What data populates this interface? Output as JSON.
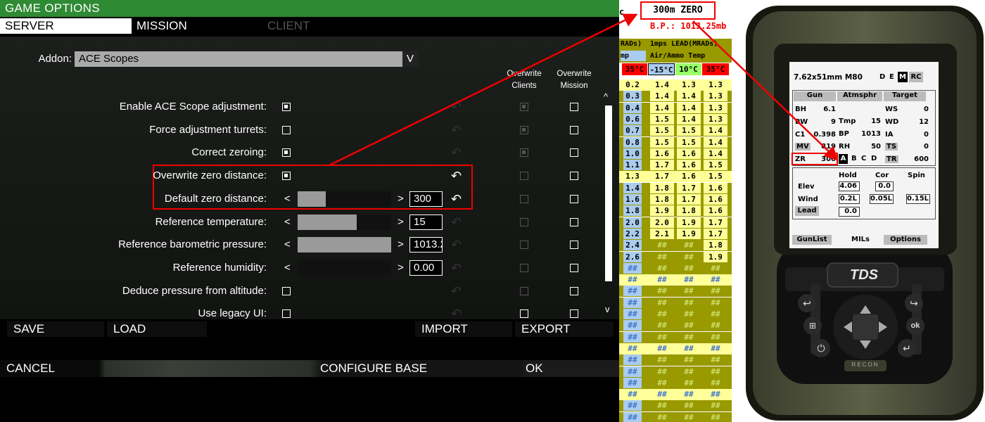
{
  "game_options": {
    "title": "GAME OPTIONS",
    "tabs": [
      {
        "label": "SERVER",
        "active": true
      },
      {
        "label": "MISSION",
        "active": false
      },
      {
        "label": "CLIENT",
        "active": false
      }
    ],
    "addon_label": "Addon:",
    "addon_value": "ACE Scopes",
    "addon_chevron": "V",
    "col_overwrite_clients": [
      "Overwrite",
      "Clients"
    ],
    "col_overwrite_mission": [
      "Overwrite",
      "Mission"
    ],
    "scroll_up": "^",
    "scroll_down": "v",
    "settings": [
      {
        "label": "Enable ACE Scope adjustment:",
        "type": "checkbox",
        "checked": true
      },
      {
        "label": "Force adjustment turrets:",
        "type": "checkbox",
        "checked": false
      },
      {
        "label": "Correct zeroing:",
        "type": "checkbox",
        "checked": true
      },
      {
        "label": "Overwrite zero distance:",
        "type": "checkbox",
        "checked": true
      },
      {
        "label": "Default zero distance:",
        "type": "slider",
        "value": "300",
        "fill": 0.2
      },
      {
        "label": "Reference temperature:",
        "type": "slider",
        "value": "15",
        "fill": 0.63
      },
      {
        "label": "Reference barometric pressure:",
        "type": "slider",
        "value": "1013.25",
        "fill": 1.0
      },
      {
        "label": "Reference humidity:",
        "type": "slider",
        "value": "0.00",
        "fill": 0.0
      },
      {
        "label": "Deduce pressure from altitude:",
        "type": "checkbox",
        "checked": false
      },
      {
        "label": "Use legacy UI:",
        "type": "checkbox",
        "checked": false
      }
    ],
    "arrow_left": "<",
    "arrow_right": ">",
    "bottom_buttons": {
      "save": "SAVE",
      "load": "LOAD",
      "import": "IMPORT",
      "export": "EXPORT"
    },
    "footer_buttons": {
      "cancel": "CANCEL",
      "configure_base": "CONFIGURE BASE",
      "ok": "OK"
    }
  },
  "ballistic_table": {
    "zero_title": "300m ZERO",
    "bp": "B.P.: 1013.25mb",
    "left_col_head": "RADs)",
    "lead_head": "1mps LEAD(MRADs)",
    "left_col_sub": "mp",
    "air_ammo_temp": "Air/Ammo Temp",
    "temps": [
      "35°C",
      "-15°C",
      "10°C",
      "35°C"
    ],
    "rows": [
      [
        "0.2",
        "1.4",
        "1.3",
        "1.3"
      ],
      [
        "0.3",
        "1.4",
        "1.4",
        "1.3"
      ],
      [
        "0.4",
        "1.4",
        "1.4",
        "1.3"
      ],
      [
        "0.6",
        "1.5",
        "1.4",
        "1.3"
      ],
      [
        "0.7",
        "1.5",
        "1.5",
        "1.4"
      ],
      [
        "0.8",
        "1.5",
        "1.5",
        "1.4"
      ],
      [
        "1.0",
        "1.6",
        "1.6",
        "1.4"
      ],
      [
        "1.1",
        "1.7",
        "1.6",
        "1.5"
      ],
      [
        "1.3",
        "1.7",
        "1.6",
        "1.5"
      ],
      [
        "1.4",
        "1.8",
        "1.7",
        "1.6"
      ],
      [
        "1.6",
        "1.8",
        "1.7",
        "1.6"
      ],
      [
        "1.8",
        "1.9",
        "1.8",
        "1.6"
      ],
      [
        "2.0",
        "2.0",
        "1.9",
        "1.7"
      ],
      [
        "2.2",
        "2.1",
        "1.9",
        "1.7"
      ],
      [
        "2.4",
        "##",
        "##",
        "1.8"
      ],
      [
        "2.6",
        "##",
        "##",
        "1.9"
      ],
      [
        "##",
        "##",
        "##",
        "##"
      ],
      [
        "##",
        "##",
        "##",
        "##"
      ],
      [
        "##",
        "##",
        "##",
        "##"
      ],
      [
        "##",
        "##",
        "##",
        "##"
      ],
      [
        "##",
        "##",
        "##",
        "##"
      ],
      [
        "##",
        "##",
        "##",
        "##"
      ],
      [
        "##",
        "##",
        "##",
        "##"
      ],
      [
        "##",
        "##",
        "##",
        "##"
      ],
      [
        "##",
        "##",
        "##",
        "##"
      ],
      [
        "##",
        "##",
        "##",
        "##"
      ],
      [
        "##",
        "##",
        "##",
        "##"
      ],
      [
        "##",
        "##",
        "##",
        "##"
      ],
      [
        "##",
        "##",
        "##",
        "##"
      ],
      [
        "##",
        "##",
        "##",
        "##"
      ]
    ],
    "colors": {
      "highlight_yellow": "#ffff99",
      "olive": "#999900",
      "blue": "#aaccee",
      "red": "#ff0000",
      "green": "#99ff66"
    }
  },
  "device": {
    "brand": "TDS",
    "model": "RECON",
    "caliber": "7.62x51mm  M80",
    "mode_keys": [
      "D",
      "E",
      "M",
      "RC"
    ],
    "sections": {
      "gun": "Gun",
      "atmosphere": "Atmsphr",
      "target": "Target"
    },
    "gun": [
      [
        "BH",
        "6.1"
      ],
      [
        "BW",
        "9"
      ],
      [
        "C1",
        "0.398"
      ],
      [
        "MV",
        "819"
      ],
      [
        "ZR",
        "300"
      ]
    ],
    "atmosphere": [
      [
        "Tmp",
        "15"
      ],
      [
        "BP",
        "1013"
      ],
      [
        "RH",
        "50"
      ]
    ],
    "target": [
      [
        "WS",
        "0"
      ],
      [
        "WD",
        "12"
      ],
      [
        "IA",
        "0"
      ],
      [
        "TS",
        "0"
      ],
      [
        "TR",
        "600"
      ]
    ],
    "target_presets": [
      "A",
      "B",
      "C",
      "D"
    ],
    "solution_heads": [
      "Hold",
      "Cor",
      "Spin"
    ],
    "elev_label": "Elev",
    "wind_label": "Wind",
    "lead_label": "Lead",
    "elev_hold": "4.06",
    "elev_cor": "0.0",
    "wind_hold": "0.2L",
    "wind_cor": "0.05L",
    "wind_spin": "0.15L",
    "lead_hold": "0.0",
    "bottom_tabs": {
      "gunlist": "GunList",
      "mils": "MILs",
      "options": "Options"
    },
    "ok_key": "ok"
  }
}
